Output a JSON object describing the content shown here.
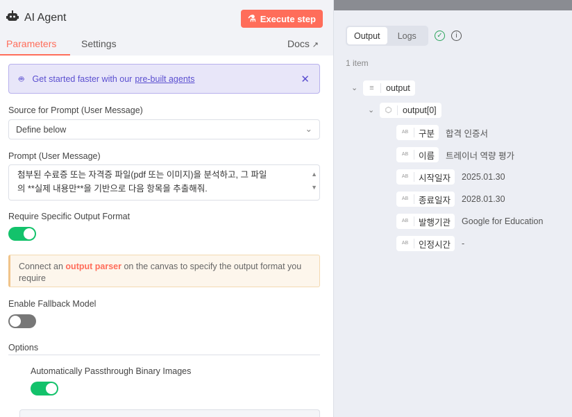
{
  "header": {
    "title": "AI Agent",
    "execute_label": "Execute step"
  },
  "tabs": {
    "parameters": "Parameters",
    "settings": "Settings",
    "docs": "Docs"
  },
  "banner": {
    "text": "Get started faster with our",
    "link": "pre-built agents"
  },
  "source": {
    "label": "Source for Prompt (User Message)",
    "value": "Define below"
  },
  "prompt": {
    "label": "Prompt (User Message)",
    "line1": "첨부된 수료증 또는 자격증 파일(pdf 또는 이미지)을 분석하고, 그 파일",
    "line2": "의 **실제 내용만**을 기반으로 다음 항목을 추출해줘."
  },
  "require_output": {
    "label": "Require Specific Output Format",
    "on": true
  },
  "notice": {
    "pre": "Connect an",
    "link": "output parser",
    "post": "on the canvas to specify the output format you require"
  },
  "fallback": {
    "label": "Enable Fallback Model",
    "on": false
  },
  "options": {
    "label": "Options",
    "passthrough_label": "Automatically Passthrough Binary Images",
    "passthrough_on": true
  },
  "output_panel": {
    "tabs": [
      "Output",
      "Logs"
    ],
    "count": "1 item",
    "root": "output",
    "child": "output[0]",
    "fields": [
      {
        "key": "구분",
        "value": "합격 인증서"
      },
      {
        "key": "이름",
        "value": "트레이너 역량 평가"
      },
      {
        "key": "시작일자",
        "value": "2025.01.30"
      },
      {
        "key": "종료일자",
        "value": "2028.01.30"
      },
      {
        "key": "발행기관",
        "value": "Google for Education"
      },
      {
        "key": "인정시간",
        "value": "-"
      }
    ],
    "type_badge": "AB"
  },
  "colors": {
    "accent": "#ff6d5a",
    "toggle_on": "#13c26b",
    "success": "#29a35a"
  }
}
